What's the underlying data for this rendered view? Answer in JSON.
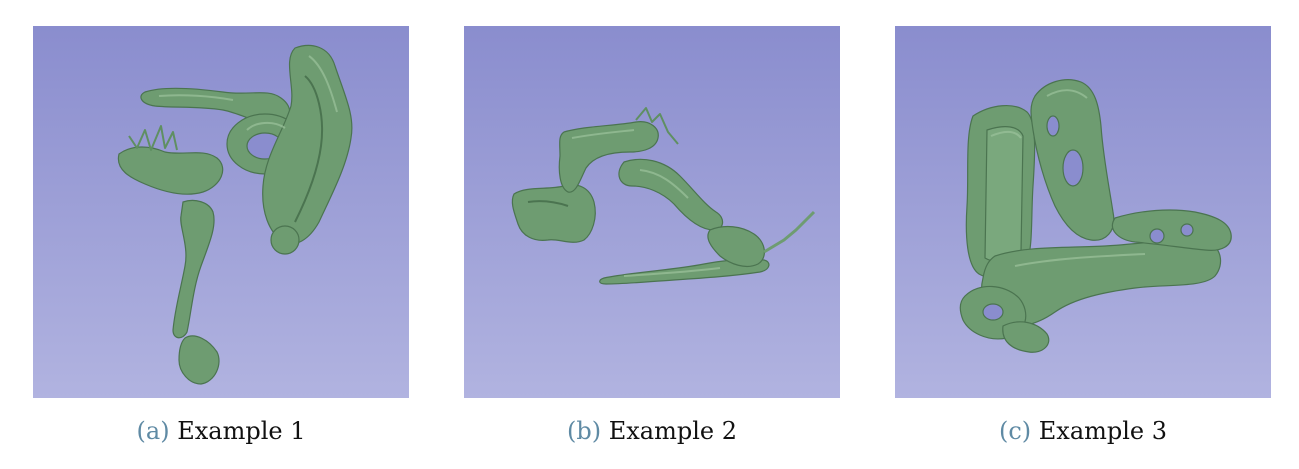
{
  "colors": {
    "bg_top": "#8c8fcf",
    "bg_bottom": "#b0b2df",
    "mesh_fill": "#6e9c71",
    "mesh_shadow": "#4b7450",
    "mesh_highlight": "#9cc39c",
    "caption_label": "#5f8aa4"
  },
  "subfigures": [
    {
      "label": "(a)",
      "caption": "Example 1"
    },
    {
      "label": "(b)",
      "caption": "Example 2"
    },
    {
      "label": "(c)",
      "caption": "Example 3"
    }
  ]
}
